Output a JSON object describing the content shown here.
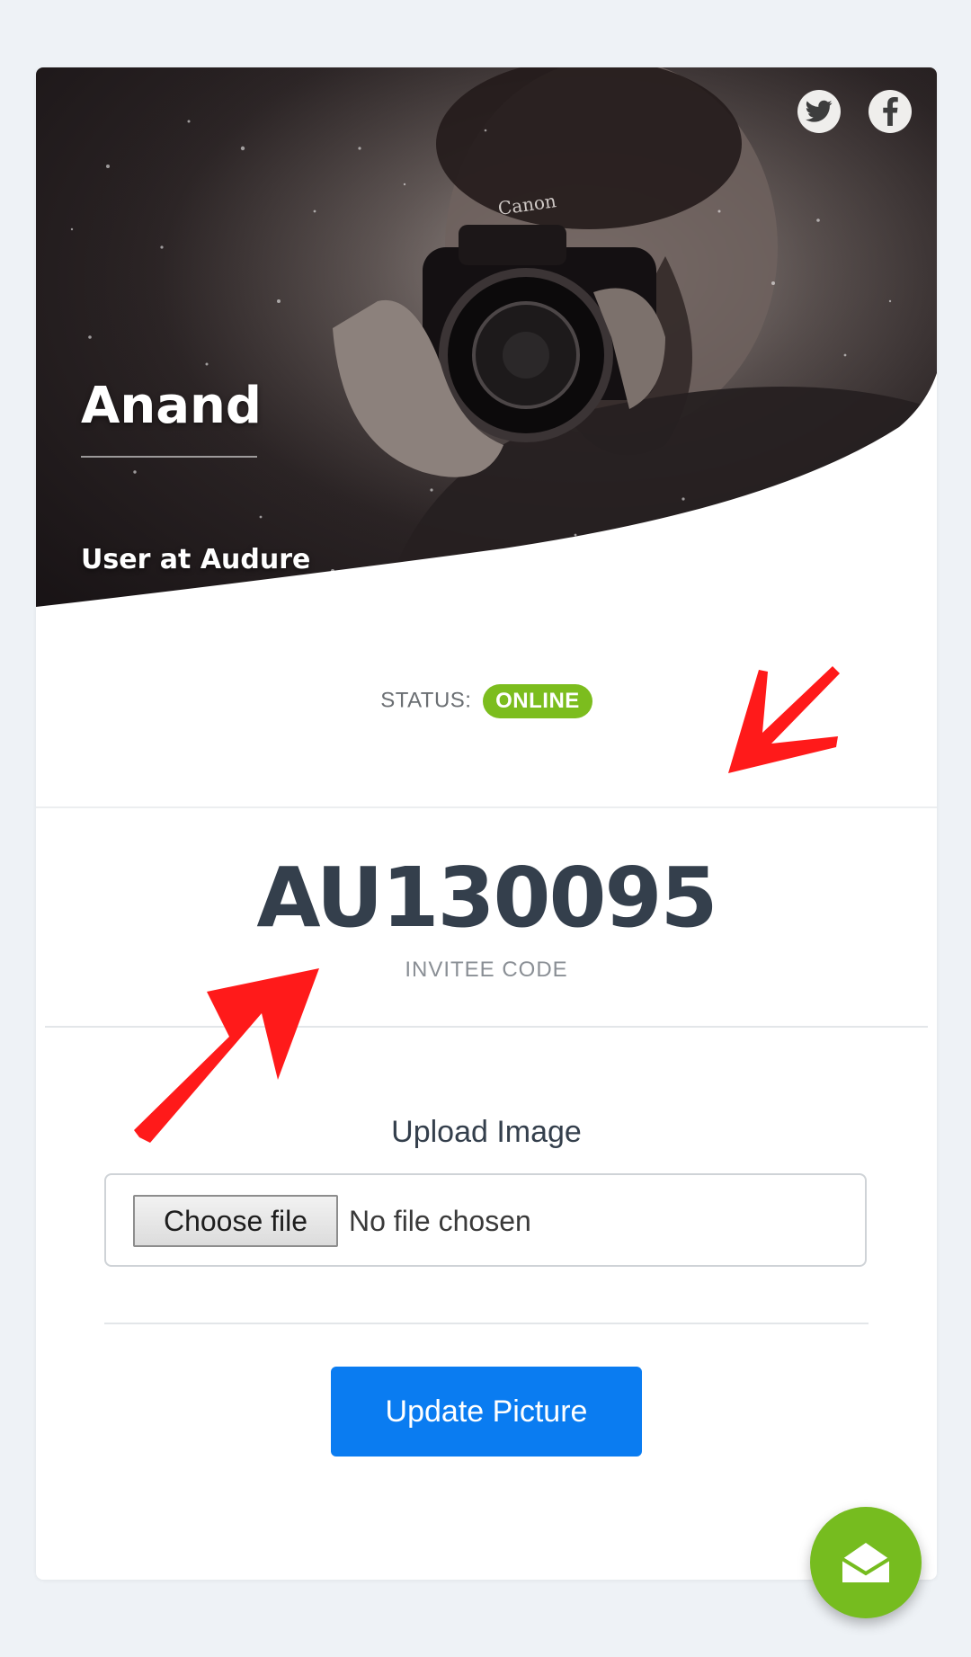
{
  "profile": {
    "name": "Anand",
    "role": "User at Audure"
  },
  "social": {
    "twitter_icon": "twitter-icon",
    "facebook_icon": "facebook-icon"
  },
  "status": {
    "label": "STATUS:",
    "value": "ONLINE",
    "color": "#7cbd1e"
  },
  "invite": {
    "code": "AU130095",
    "label": "INVITEE CODE"
  },
  "upload": {
    "heading": "Upload Image",
    "choose_label": "Choose file",
    "no_file_text": "No file chosen",
    "submit_label": "Update Picture",
    "submit_color": "#0a7cf1"
  },
  "fab": {
    "icon": "envelope-open-icon",
    "color": "#76bc1f"
  },
  "annotations": {
    "arrow_color": "#ff1a1a"
  }
}
